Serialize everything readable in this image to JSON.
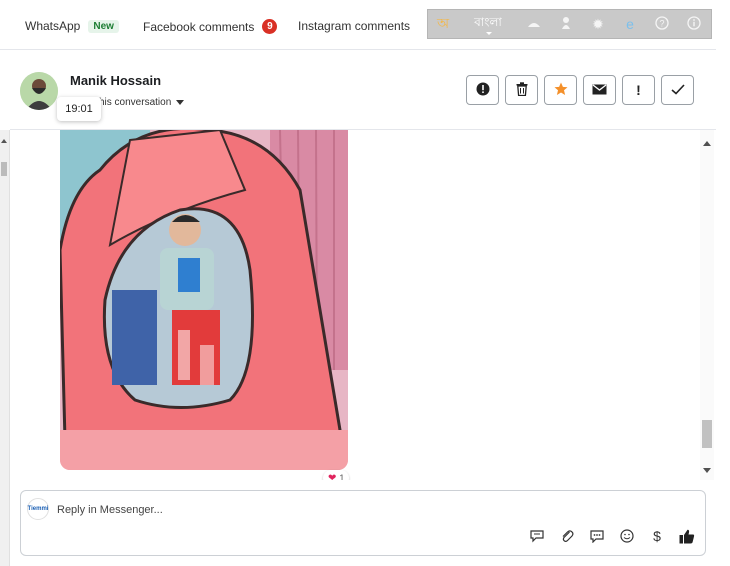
{
  "tabs": [
    {
      "label": "WhatsApp",
      "badge": "New"
    },
    {
      "label": "Facebook comments",
      "badge": "9"
    },
    {
      "label": "Instagram comments"
    }
  ],
  "language_bar": {
    "script_glyph": "অ",
    "language": "বাংলা"
  },
  "conversation": {
    "user_name": "Manik Hossain",
    "assign_label": "his conversation",
    "time_tooltip": "19:01"
  },
  "action_buttons": [
    "report-icon",
    "trash-icon",
    "star-icon",
    "envelope-icon",
    "exclamation-icon",
    "check-icon"
  ],
  "message": {
    "reaction_emoji": "❤",
    "reaction_count": "1"
  },
  "reply": {
    "placeholder": "Reply in Messenger...",
    "page_logo_text": "Tiemmi"
  },
  "colors": {
    "new_badge": "#1e7e34",
    "count_badge": "#d93025",
    "star": "#f4902a",
    "language_bar": "#c9c9c9"
  }
}
